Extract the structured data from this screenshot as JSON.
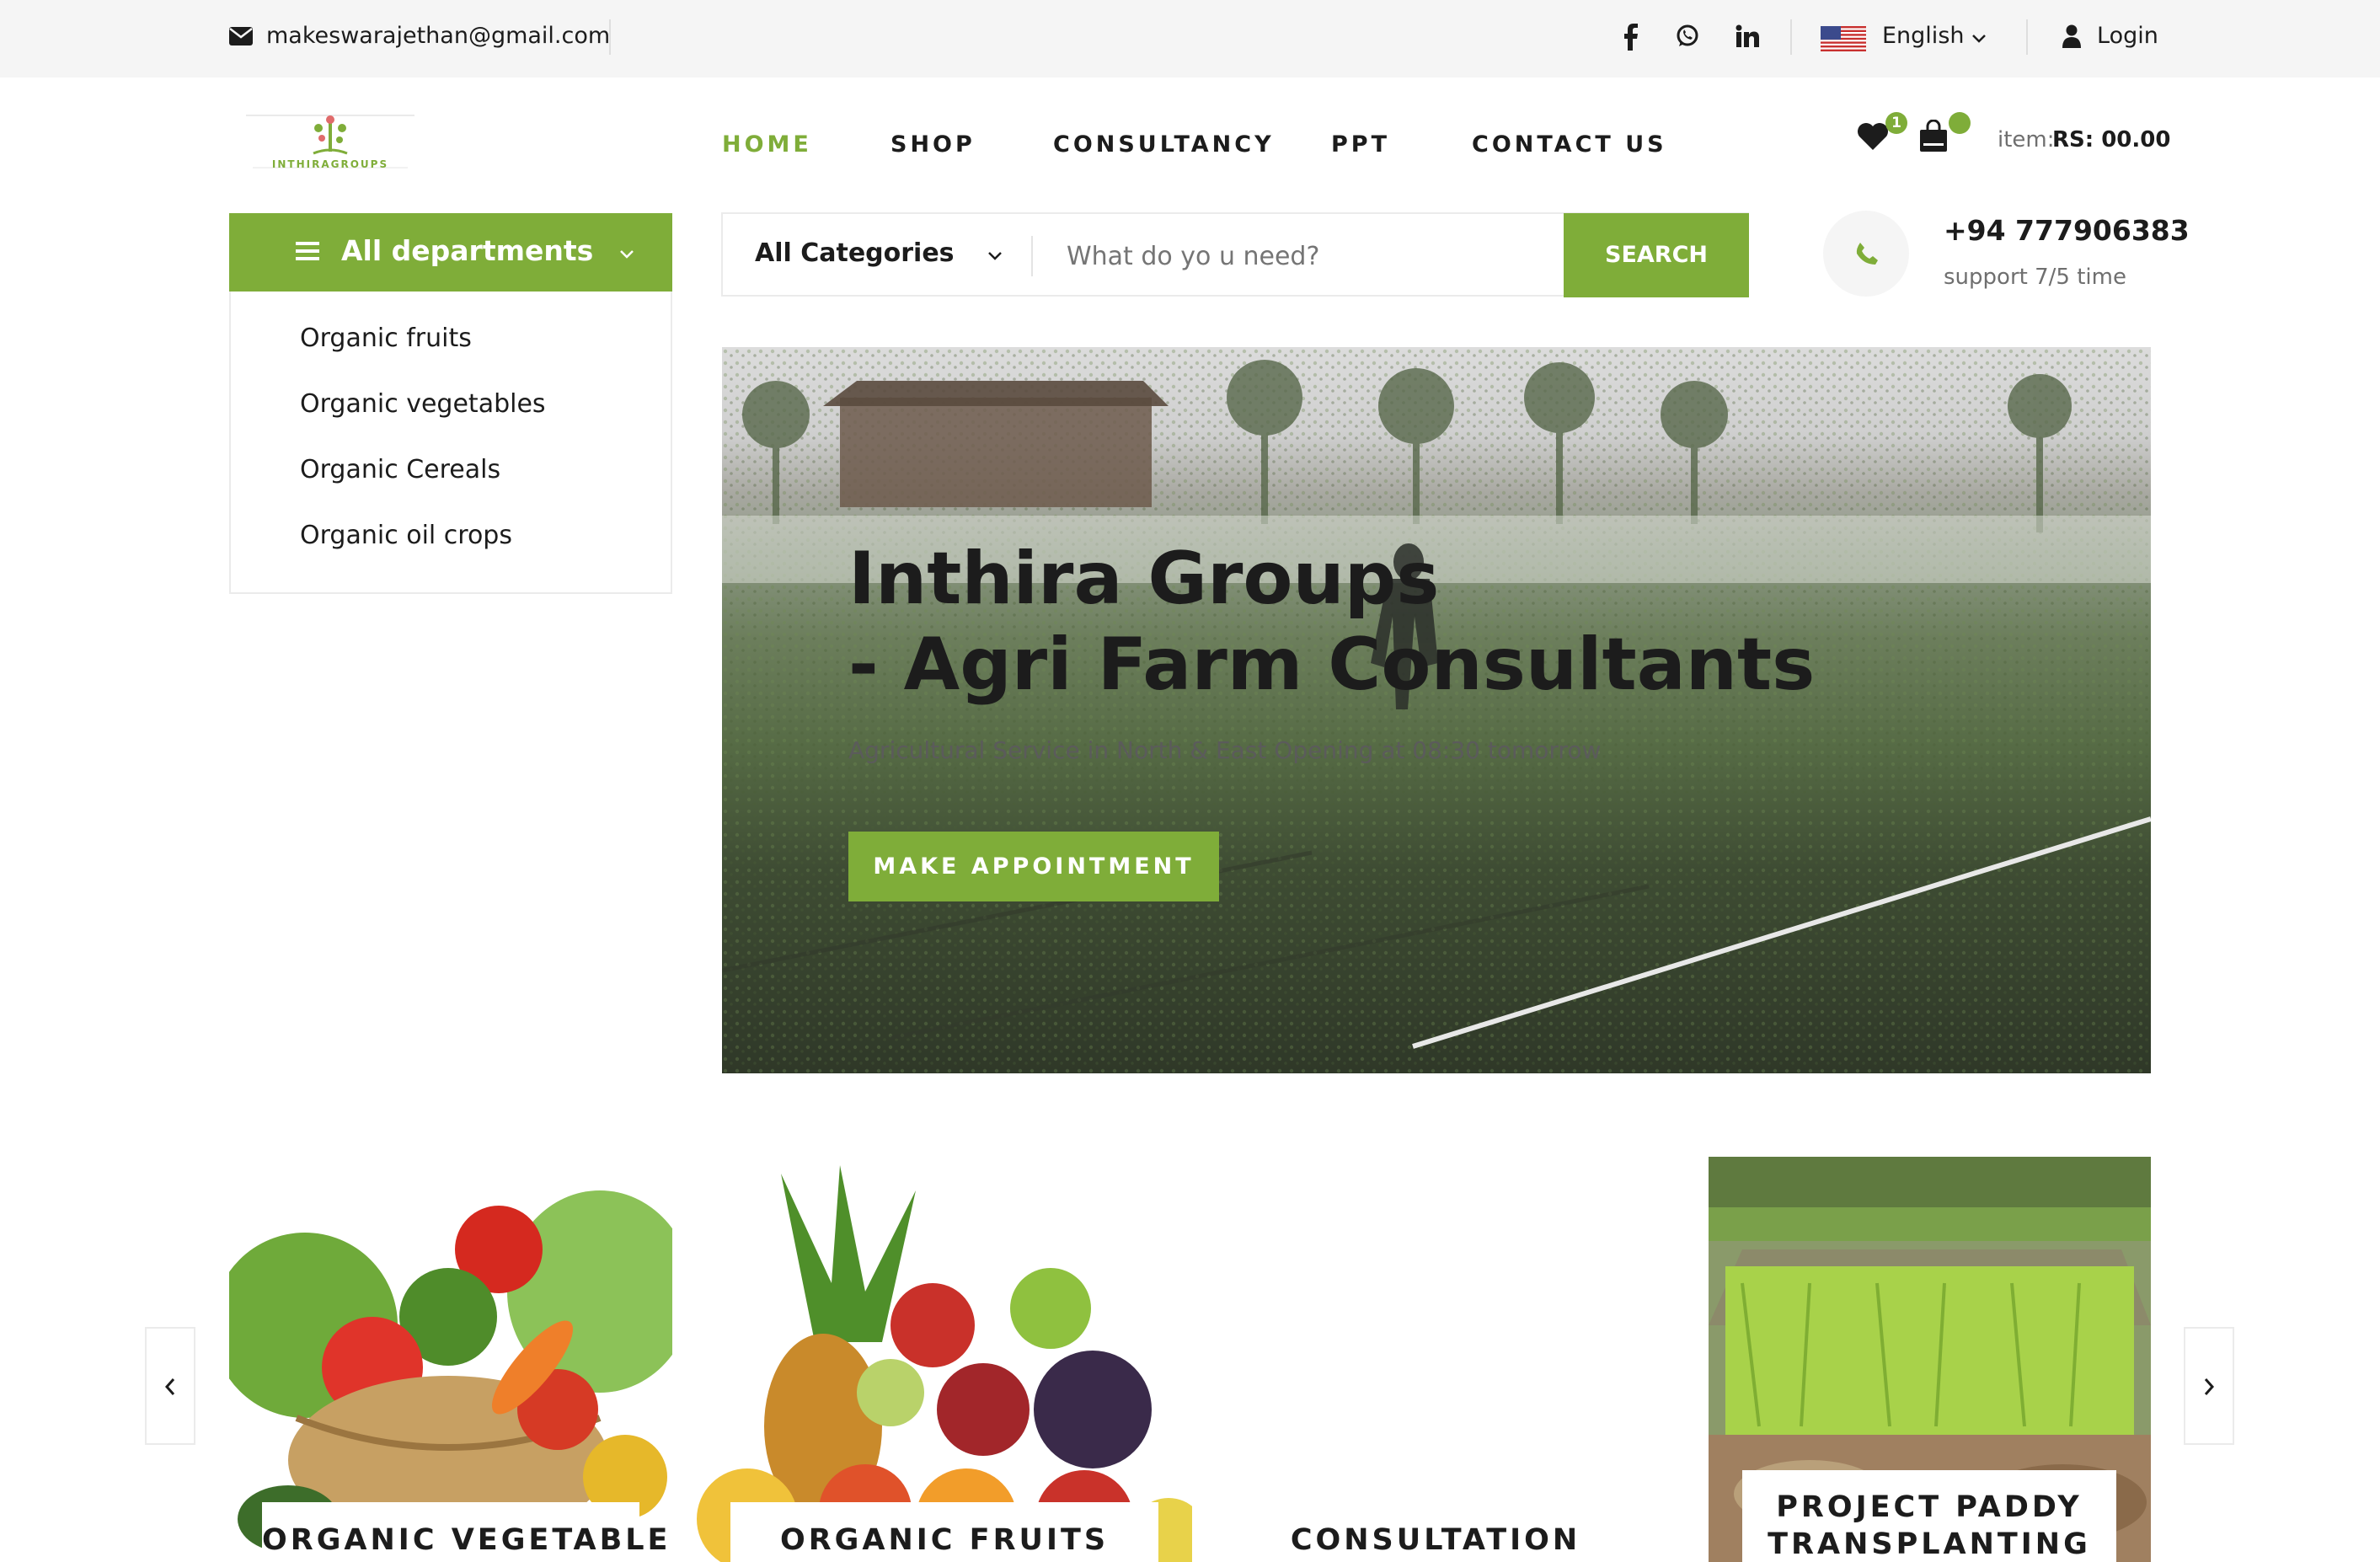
{
  "topbar": {
    "email": "makeswarajethan@gmail.com",
    "social_icons": [
      "facebook-icon",
      "whatsapp-icon",
      "linkedin-icon"
    ],
    "language": "English",
    "login": "Login"
  },
  "header": {
    "logo_text": "INTHIRAGROUPS",
    "nav": [
      "HOME",
      "SHOP",
      "CONSULTANCY",
      "PPT",
      "CONTACT US"
    ],
    "active_nav": "HOME",
    "wishlist_count": "1",
    "cart_count": "",
    "item_label": "item:",
    "item_price": "RS: 00.00"
  },
  "departments": {
    "title": "All departments",
    "items": [
      "Organic fruits",
      "Organic vegetables",
      "Organic Cereals",
      "Organic oil crops"
    ]
  },
  "search": {
    "category": "All Categories",
    "placeholder": "What do yo u need?",
    "button": "SEARCH"
  },
  "contact": {
    "phone": "+94 777906383",
    "support": "support 7/5 time"
  },
  "hero": {
    "title_line1": "Inthira Groups",
    "title_line2": "- Agri Farm Consultants",
    "subtitle": "Agricultural Service in North & East Opening at 08:30 tomorrow",
    "button": "MAKE APPOINTMENT"
  },
  "categories": [
    {
      "label": "ORGANIC VEGETABLES"
    },
    {
      "label": "ORGANIC FRUITS"
    },
    {
      "label": "CONSULTATION"
    },
    {
      "label_line1": "PROJECT PADDY",
      "label_line2": "TRANSPLANTING"
    }
  ],
  "colors": {
    "accent": "#7fad39",
    "topbar_bg": "#f5f5f5",
    "text": "#1c1c1c"
  }
}
